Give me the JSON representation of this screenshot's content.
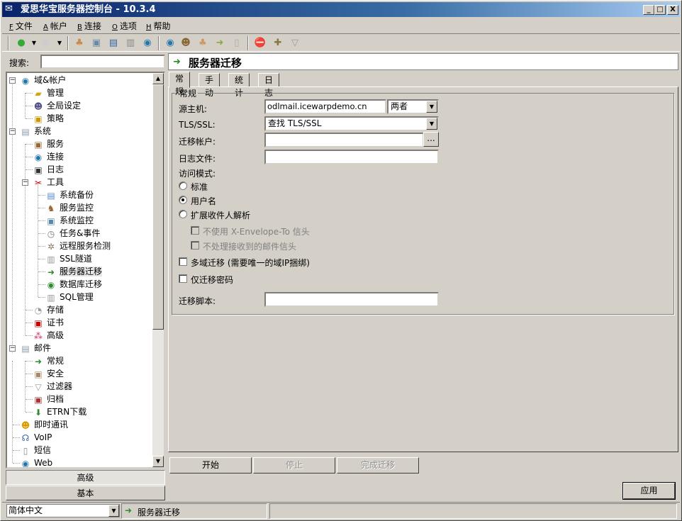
{
  "window": {
    "title": "爱思华宝服务器控制台 - 10.3.4",
    "min": "_",
    "max": "□",
    "close": "X"
  },
  "menu": [
    {
      "key": "F",
      "label": "文件"
    },
    {
      "key": "A",
      "label": "帐户"
    },
    {
      "key": "B",
      "label": "连接"
    },
    {
      "key": "O",
      "label": "选项"
    },
    {
      "key": "H",
      "label": "帮助"
    }
  ],
  "search": {
    "label": "搜索:",
    "value": ""
  },
  "tree": {
    "root_domains": "域&帐户",
    "manage": "管理",
    "global": "全局设定",
    "policy": "策略",
    "system": "系统",
    "services": "服务",
    "connection": "连接",
    "log": "日志",
    "tools": "工具",
    "backup": "系统备份",
    "service_monitor": "服务监控",
    "system_monitor": "系统监控",
    "tasks": "任务&事件",
    "remote_check": "远程服务检测",
    "ssl_tunnel": "SSL隧道",
    "migration": "服务器迁移",
    "db_migration": "数据库迁移",
    "sql_manager": "SQL管理",
    "storage": "存储",
    "certs": "证书",
    "advanced": "高级",
    "mail": "邮件",
    "mail_general": "常规",
    "security": "安全",
    "filters": "过滤器",
    "archive": "归档",
    "etrn": "ETRN下载",
    "im": "即时通讯",
    "voip": "VoIP",
    "sms": "短信",
    "web": "Web"
  },
  "mode_buttons": {
    "advanced": "高级",
    "basic": "基本"
  },
  "header": {
    "title": "服务器迁移"
  },
  "tabs": [
    "常规",
    "手动",
    "统计",
    "日志"
  ],
  "form": {
    "group_label": "常规",
    "source_host_label": "源主机:",
    "source_host_value": "odlmail.icewarpdemo.cn",
    "source_mode": "两者",
    "tls_label": "TLS/SSL:",
    "tls_value": "查找 TLS/SSL",
    "account_label": "迁移帐户:",
    "account_value": "",
    "browse": "...",
    "logfile_label": "日志文件:",
    "logfile_value": "",
    "access_label": "访问模式:",
    "radio_standard": "标准",
    "radio_username": "用户名",
    "radio_extended": "扩展收件人解析",
    "chk_no_xenvelope": "不使用 X-Envelope-To 信头",
    "chk_no_received": "不处理接收到的邮件信头",
    "chk_multidomain": "多域迁移 (需要唯一的域IP捆绑)",
    "chk_pwd_only": "仅迁移密码",
    "script_label": "迁移脚本:",
    "script_value": ""
  },
  "actions": {
    "start": "开始",
    "stop": "停止",
    "finish": "完成迁移",
    "apply": "应用"
  },
  "status": {
    "language": "简体中文",
    "section": "服务器迁移"
  }
}
